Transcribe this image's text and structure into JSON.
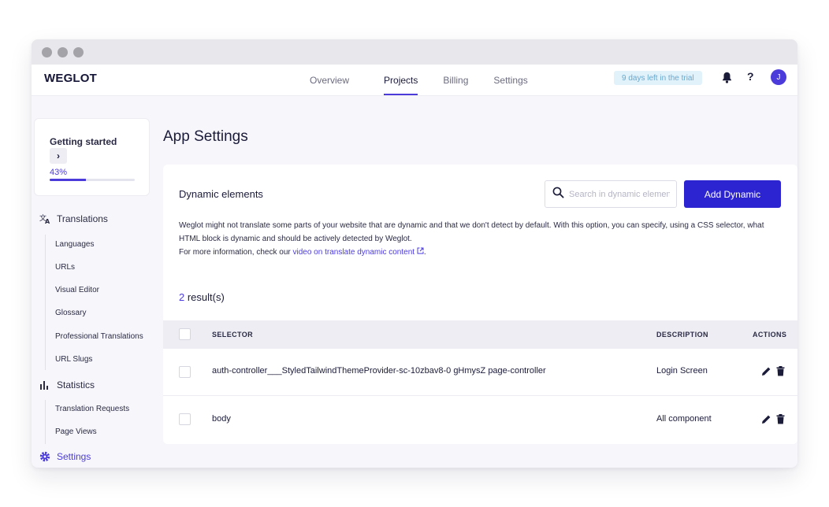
{
  "app": {
    "logo": "WEGLOT",
    "nav": [
      {
        "label": "Overview",
        "active": false
      },
      {
        "label": "Projects",
        "active": true
      },
      {
        "label": "Billing",
        "active": false
      },
      {
        "label": "Settings",
        "active": false
      }
    ],
    "trial_badge": "9 days left in the trial",
    "help_label": "?",
    "avatar_initial": "J",
    "accent_color": "#4b3bdb",
    "button_color": "#2c24d0"
  },
  "sidebar": {
    "getting_started": {
      "title": "Getting started",
      "arrow": "›",
      "percent_label": "43%",
      "progress": 0.43
    },
    "sections": [
      {
        "label": "Translations",
        "icon": "translate-icon",
        "items": [
          "Languages",
          "URLs",
          "Visual Editor",
          "Glossary",
          "Professional Translations",
          "URL Slugs"
        ]
      },
      {
        "label": "Statistics",
        "icon": "bar-chart-icon",
        "items": [
          "Translation Requests",
          "Page Views"
        ]
      },
      {
        "label": "Settings",
        "icon": "gear-icon",
        "active": true,
        "items": []
      }
    ]
  },
  "main": {
    "page_title": "App Settings",
    "panel": {
      "title": "Dynamic elements",
      "search_placeholder": "Search in dynamic elements",
      "add_button": "Add Dynamic",
      "description_line1": "Weglot might not translate some parts of your website that are dynamic and that we don't detect by default. With this option, you can specify, using a CSS selector, what HTML block is dynamic and should be actively detected by Weglot.",
      "description_line2_prefix": "For more information, check our ",
      "description_link": "video on translate dynamic content",
      "description_line2_suffix": ".",
      "result_count": "2",
      "result_suffix": " result(s)",
      "columns": {
        "selector": "SELECTOR",
        "description": "DESCRIPTION",
        "actions": "ACTIONS"
      },
      "rows": [
        {
          "selector": "auth-controller___StyledTailwindThemeProvider-sc-10zbav8-0 gHmysZ page-controller",
          "description": "Login Screen"
        },
        {
          "selector": "body",
          "description": "All component"
        }
      ]
    }
  }
}
